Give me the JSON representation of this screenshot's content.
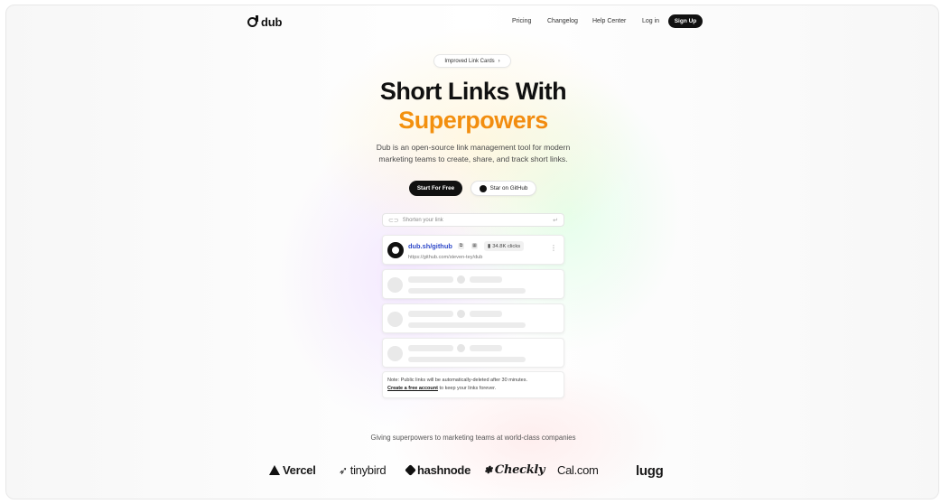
{
  "brand": {
    "name": "dub"
  },
  "nav": {
    "links": [
      "Pricing",
      "Changelog",
      "Help Center",
      "Log in"
    ],
    "signup_label": "Sign Up"
  },
  "announcement": {
    "label": "Improved Link Cards",
    "chevron": "›"
  },
  "hero": {
    "title_line1": "Short Links With",
    "title_line2": "Superpowers",
    "subtitle_line1": "Dub is an open-source link management tool for modern",
    "subtitle_line2": "marketing teams to create, share, and track short links.",
    "primary_cta": "Start For Free",
    "secondary_cta": "Star on GitHub"
  },
  "demo": {
    "input_placeholder": "Shorten your link",
    "link_card": {
      "short_url": "dub.sh/github",
      "long_url": "https://github.com/steven-tey/dub",
      "clicks": "34.8K clicks"
    },
    "note_text": "Note: Public links will be automatically-deleted after 30 minutes.",
    "note_link": "Create a free account",
    "note_suffix": " to keep your links forever."
  },
  "trust": {
    "heading": "Giving superpowers to marketing teams at world-class companies",
    "logos": [
      "Vercel",
      "tinybird",
      "hashnode",
      "Checkly",
      "Cal.com",
      "lugg"
    ]
  },
  "colors": {
    "accent_gradient_start": "#f5a20a",
    "accent_gradient_end": "#f07a14",
    "link_blue": "#2f49c9",
    "dark": "#111111"
  }
}
